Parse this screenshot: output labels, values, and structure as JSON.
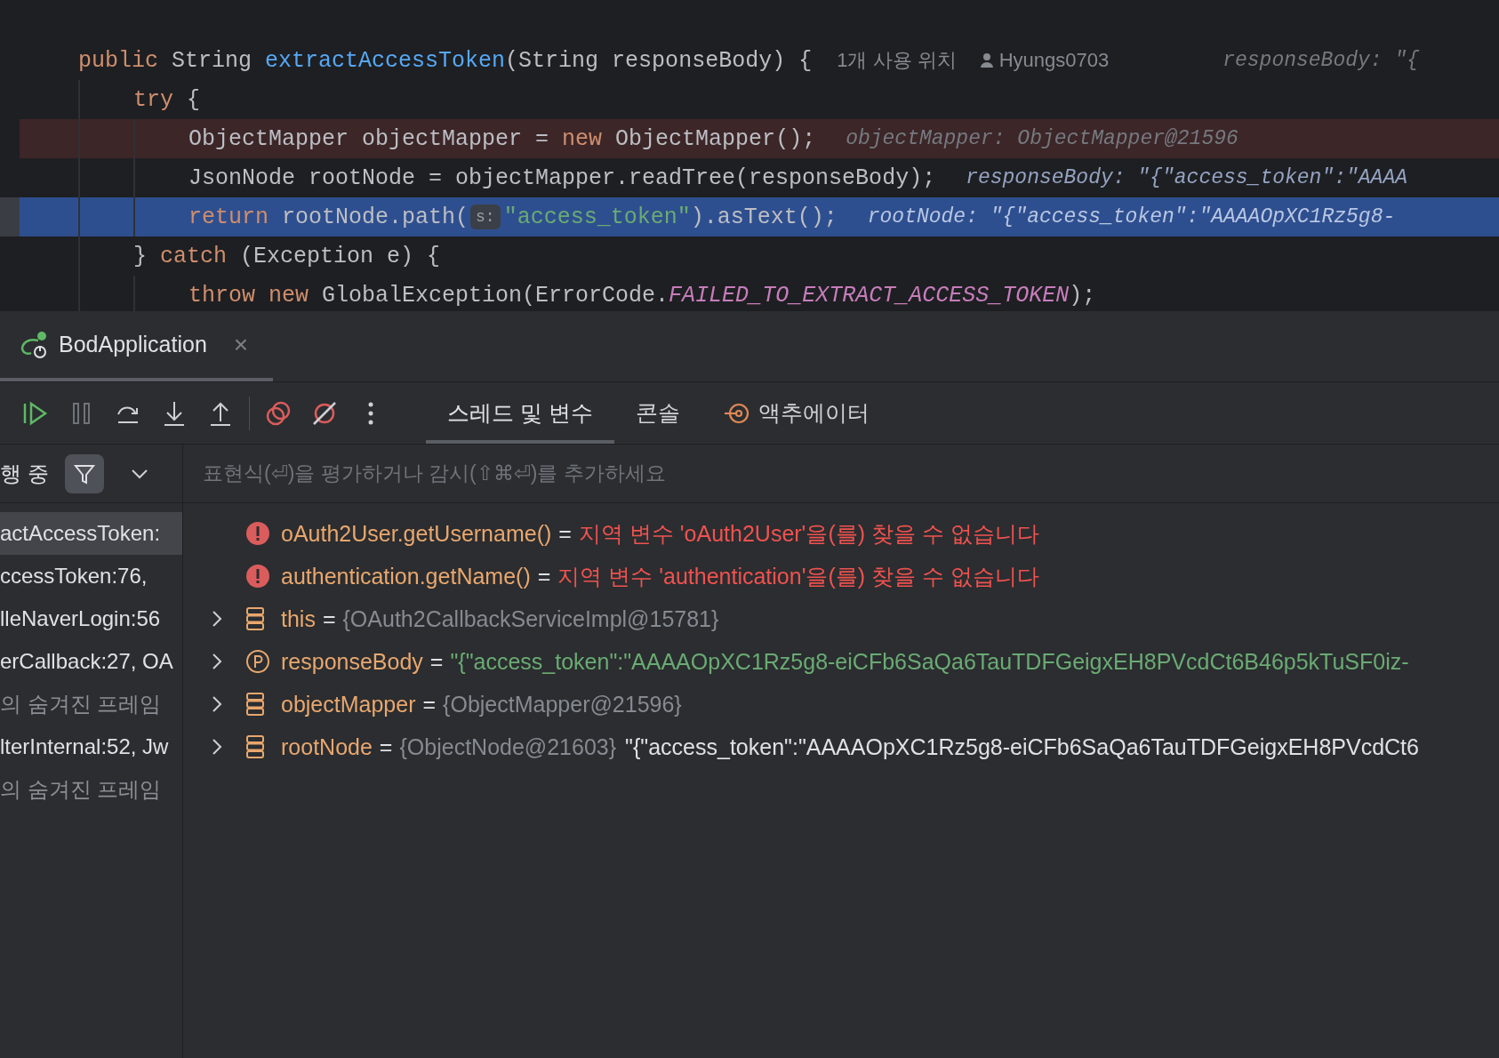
{
  "editor": {
    "lines": [
      {
        "breakpoint": false,
        "current": false,
        "segments": [
          {
            "kind": "keyword",
            "text": "public"
          },
          {
            "kind": "plain",
            "text": " String "
          },
          {
            "kind": "method",
            "text": "extractAccessToken"
          },
          {
            "kind": "plain",
            "text": "(String responseBody) {"
          }
        ],
        "usages": "1개 사용 위치",
        "author": "Hyungs0703",
        "inline": {
          "kind": "hint",
          "text": "responseBody: \"{"
        },
        "children": [
          {
            "breakpoint": false,
            "current": false,
            "segments": [
              {
                "kind": "keyword",
                "text": "try"
              },
              {
                "kind": "plain",
                "text": " {"
              }
            ],
            "children": [
              {
                "breakpoint": true,
                "current": false,
                "segments": [
                  {
                    "kind": "plain",
                    "text": "ObjectMapper objectMapper = "
                  },
                  {
                    "kind": "keyword",
                    "text": "new"
                  },
                  {
                    "kind": "plain",
                    "text": " ObjectMapper();"
                  }
                ],
                "inline": {
                  "kind": "hint",
                  "text": "objectMapper: ObjectMapper@21596"
                }
              },
              {
                "breakpoint": false,
                "current": false,
                "segments": [
                  {
                    "kind": "plain",
                    "text": "JsonNode rootNode = objectMapper.readTree(responseBody);"
                  }
                ],
                "inline": {
                  "kind": "value",
                  "text": "responseBody: \"{\"access_token\":\"AAAA"
                }
              },
              {
                "breakpoint": false,
                "current": true,
                "segments": [
                  {
                    "kind": "keyword",
                    "text": "return"
                  },
                  {
                    "kind": "plain",
                    "text": " rootNode.path("
                  },
                  {
                    "kind": "param",
                    "text": "s:"
                  },
                  {
                    "kind": "string",
                    "text": "\"access_token\""
                  },
                  {
                    "kind": "plain",
                    "text": ").asText();"
                  }
                ],
                "inline": {
                  "kind": "value",
                  "text": "rootNode: \"{\"access_token\":\"AAAAOpXC1Rz5g8-"
                }
              }
            ]
          },
          {
            "breakpoint": false,
            "current": false,
            "segments": [
              {
                "kind": "plain",
                "text": "} "
              },
              {
                "kind": "keyword",
                "text": "catch"
              },
              {
                "kind": "plain",
                "text": " (Exception e) {"
              }
            ],
            "children": [
              {
                "breakpoint": false,
                "current": false,
                "segments": [
                  {
                    "kind": "keyword",
                    "text": "throw new"
                  },
                  {
                    "kind": "plain",
                    "text": " GlobalException(ErrorCode."
                  },
                  {
                    "kind": "constant",
                    "text": "FAILED_TO_EXTRACT_ACCESS_TOKEN"
                  },
                  {
                    "kind": "plain",
                    "text": ");"
                  }
                ]
              }
            ]
          }
        ]
      }
    ]
  },
  "debug": {
    "session_tab": {
      "title": "BodApplication",
      "close": "×"
    },
    "tabs": [
      {
        "label": "스레드 및 변수",
        "selected": true,
        "icon": false
      },
      {
        "label": "콘솔",
        "selected": false,
        "icon": false
      },
      {
        "label": "액추에이터",
        "selected": false,
        "icon": true
      }
    ],
    "frames": {
      "status": "행 중",
      "filter_on": true,
      "items": [
        {
          "text": "actAccessToken:",
          "selected": true,
          "hidden": false
        },
        {
          "text": "ccessToken:76,",
          "selected": false,
          "hidden": false
        },
        {
          "text": "lleNaverLogin:56",
          "selected": false,
          "hidden": false
        },
        {
          "text": "erCallback:27, OA",
          "selected": false,
          "hidden": false
        },
        {
          "text": "의 숨겨진 프레임",
          "selected": false,
          "hidden": true
        },
        {
          "text": "lterInternal:52, Jw",
          "selected": false,
          "hidden": false
        },
        {
          "text": "의 숨겨진 프레임",
          "selected": false,
          "hidden": true
        }
      ]
    },
    "expression": {
      "placeholder": "표현식(⏎)을 평가하거나 감시(⇧⌘⏎)를 추가하세요"
    },
    "variables": [
      {
        "kind": "error",
        "name": "oAuth2User.getUsername()",
        "equals": "=",
        "message": "지역 변수 'oAuth2User'을(를) 찾을 수 없습니다"
      },
      {
        "kind": "error",
        "name": "authentication.getName()",
        "equals": "=",
        "message": "지역 변수 'authentication'을(를) 찾을 수 없습니다"
      },
      {
        "kind": "field",
        "name": "this",
        "equals": "=",
        "type": "{OAuth2CallbackServiceImpl@15781}"
      },
      {
        "kind": "param",
        "name": "responseBody",
        "equals": "=",
        "string": "\"{\"access_token\":\"AAAAOpXC1Rz5g8-eiCFb6SaQa6TauTDFGeigxEH8PVcdCt6B46p5kTuSF0iz-"
      },
      {
        "kind": "field",
        "name": "objectMapper",
        "equals": "=",
        "type": "{ObjectMapper@21596}"
      },
      {
        "kind": "field",
        "name": "rootNode",
        "equals": "=",
        "type": "{ObjectNode@21603}",
        "value": "\"{\"access_token\":\"AAAAOpXC1Rz5g8-eiCFb6SaQa6TauTDFGeigxEH8PVcdCt6"
      }
    ]
  }
}
